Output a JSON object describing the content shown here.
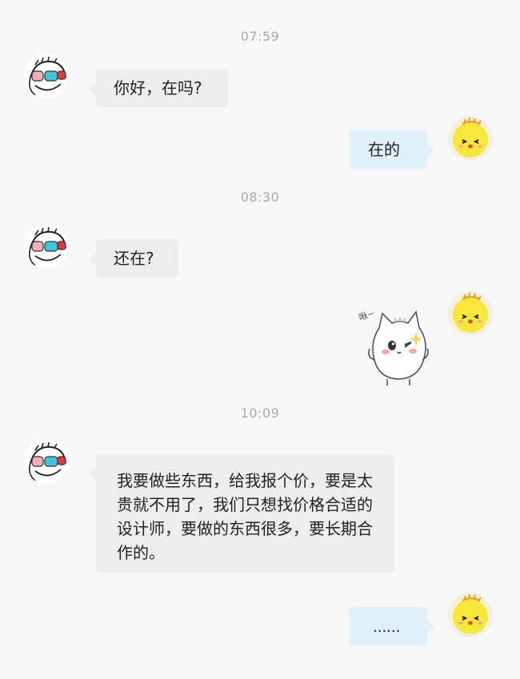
{
  "messages": [
    {
      "timestamp": "07:59"
    },
    {
      "text": "你好，在吗?"
    },
    {
      "text": "在的"
    },
    {
      "timestamp": "08:30"
    },
    {
      "text": "还在?"
    },
    {
      "sticker_caption": "啾~"
    },
    {
      "timestamp": "10:09"
    },
    {
      "text": "我要做些东西，给我报个价，要是太贵就不用了，我们只想找价格合适的设计师，要做的东西很多，要长期合作的。"
    },
    {
      "text": "......"
    }
  ],
  "icons": {
    "sender_avatar": "glasses-cartoon-avatar-icon",
    "self_avatar": "yellow-chick-avatar-icon",
    "sticker": "cat-wink-sticker-icon"
  },
  "colors": {
    "incoming_bubble": "#ededed",
    "outgoing_bubble": "#dff0fb",
    "timestamp": "#a9a9a9",
    "background": "#f7f7f7"
  }
}
